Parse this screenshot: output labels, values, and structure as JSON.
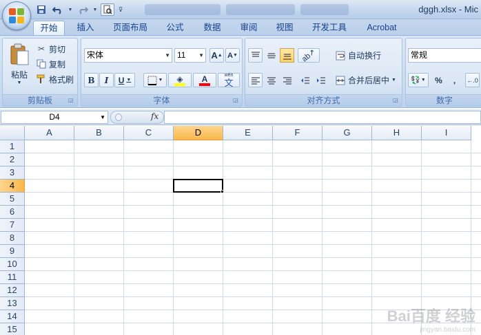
{
  "window": {
    "title": "dggh.xlsx - Mic"
  },
  "quick_access": {
    "icons": [
      "save-icon",
      "undo-icon",
      "redo-icon",
      "print-preview-icon",
      "customize-icon"
    ]
  },
  "tabs": [
    {
      "label": "开始",
      "active": true
    },
    {
      "label": "插入"
    },
    {
      "label": "页面布局"
    },
    {
      "label": "公式"
    },
    {
      "label": "数据"
    },
    {
      "label": "审阅"
    },
    {
      "label": "视图"
    },
    {
      "label": "开发工具"
    },
    {
      "label": "Acrobat"
    }
  ],
  "clipboard": {
    "group_label": "剪贴板",
    "paste": "粘贴",
    "cut": "剪切",
    "copy": "复制",
    "format_painter": "格式刷"
  },
  "font": {
    "group_label": "字体",
    "font_name": "宋体",
    "font_size": "11",
    "bold": "B",
    "italic": "I",
    "underline": "U",
    "font_color_letter": "A",
    "phonetic": "wén",
    "grow": "A",
    "shrink": "A"
  },
  "alignment": {
    "group_label": "对齐方式",
    "wrap_text": "自动换行",
    "merge_center": "合并后居中"
  },
  "number": {
    "group_label": "数字",
    "format": "常规",
    "percent": "%",
    "comma": ","
  },
  "formula_bar": {
    "name_box": "D4",
    "fx": "fx",
    "content": ""
  },
  "sheet": {
    "columns": [
      "A",
      "B",
      "C",
      "D",
      "E",
      "F",
      "G",
      "H",
      "I"
    ],
    "rows": [
      "1",
      "2",
      "3",
      "4",
      "5",
      "6",
      "7",
      "8",
      "9",
      "10",
      "11",
      "12",
      "13",
      "14",
      "15"
    ],
    "active_cell": "D4"
  },
  "watermark": {
    "main": "Bai百度 经验",
    "sub": "jingyan.baidu.com"
  },
  "colors": {
    "accent": "#15428b",
    "selection_header": "#f8b84a",
    "font_color_bar": "#ff0000",
    "fill_color_bar": "#ffff00"
  }
}
